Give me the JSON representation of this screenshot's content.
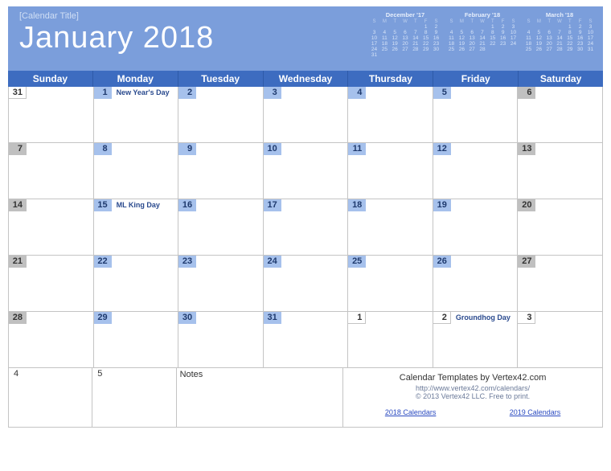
{
  "header": {
    "placeholder": "[Calendar Title]",
    "title": "January 2018",
    "mini": [
      {
        "title": "December '17",
        "dow": [
          "S",
          "M",
          "T",
          "W",
          "T",
          "F",
          "S"
        ],
        "rows": [
          [
            "",
            "",
            "",
            "",
            "",
            "1",
            "2"
          ],
          [
            "3",
            "4",
            "5",
            "6",
            "7",
            "8",
            "9"
          ],
          [
            "10",
            "11",
            "12",
            "13",
            "14",
            "15",
            "16"
          ],
          [
            "17",
            "18",
            "19",
            "20",
            "21",
            "22",
            "23"
          ],
          [
            "24",
            "25",
            "26",
            "27",
            "28",
            "29",
            "30"
          ],
          [
            "31",
            "",
            "",
            "",
            "",
            "",
            ""
          ]
        ]
      },
      {
        "title": "February '18",
        "dow": [
          "S",
          "M",
          "T",
          "W",
          "T",
          "F",
          "S"
        ],
        "rows": [
          [
            "",
            "",
            "",
            "",
            "1",
            "2",
            "3"
          ],
          [
            "4",
            "5",
            "6",
            "7",
            "8",
            "9",
            "10"
          ],
          [
            "11",
            "12",
            "13",
            "14",
            "15",
            "16",
            "17"
          ],
          [
            "18",
            "19",
            "20",
            "21",
            "22",
            "23",
            "24"
          ],
          [
            "25",
            "26",
            "27",
            "28",
            "",
            "",
            ""
          ]
        ]
      },
      {
        "title": "March '18",
        "dow": [
          "S",
          "M",
          "T",
          "W",
          "T",
          "F",
          "S"
        ],
        "rows": [
          [
            "",
            "",
            "",
            "",
            "1",
            "2",
            "3"
          ],
          [
            "4",
            "5",
            "6",
            "7",
            "8",
            "9",
            "10"
          ],
          [
            "11",
            "12",
            "13",
            "14",
            "15",
            "16",
            "17"
          ],
          [
            "18",
            "19",
            "20",
            "21",
            "22",
            "23",
            "24"
          ],
          [
            "25",
            "26",
            "27",
            "28",
            "29",
            "30",
            "31"
          ]
        ]
      }
    ]
  },
  "dow": [
    "Sunday",
    "Monday",
    "Tuesday",
    "Wednesday",
    "Thursday",
    "Friday",
    "Saturday"
  ],
  "weeks": [
    [
      {
        "n": "31",
        "type": "plain"
      },
      {
        "n": "1",
        "type": "blue",
        "event": "New Year's Day"
      },
      {
        "n": "2",
        "type": "blue"
      },
      {
        "n": "3",
        "type": "blue"
      },
      {
        "n": "4",
        "type": "blue"
      },
      {
        "n": "5",
        "type": "blue"
      },
      {
        "n": "6",
        "type": "gray"
      }
    ],
    [
      {
        "n": "7",
        "type": "gray"
      },
      {
        "n": "8",
        "type": "blue"
      },
      {
        "n": "9",
        "type": "blue"
      },
      {
        "n": "10",
        "type": "blue"
      },
      {
        "n": "11",
        "type": "blue"
      },
      {
        "n": "12",
        "type": "blue"
      },
      {
        "n": "13",
        "type": "gray"
      }
    ],
    [
      {
        "n": "14",
        "type": "gray"
      },
      {
        "n": "15",
        "type": "blue",
        "event": "ML King Day"
      },
      {
        "n": "16",
        "type": "blue"
      },
      {
        "n": "17",
        "type": "blue"
      },
      {
        "n": "18",
        "type": "blue"
      },
      {
        "n": "19",
        "type": "blue"
      },
      {
        "n": "20",
        "type": "gray"
      }
    ],
    [
      {
        "n": "21",
        "type": "gray"
      },
      {
        "n": "22",
        "type": "blue"
      },
      {
        "n": "23",
        "type": "blue"
      },
      {
        "n": "24",
        "type": "blue"
      },
      {
        "n": "25",
        "type": "blue"
      },
      {
        "n": "26",
        "type": "blue"
      },
      {
        "n": "27",
        "type": "gray"
      }
    ],
    [
      {
        "n": "28",
        "type": "gray"
      },
      {
        "n": "29",
        "type": "blue"
      },
      {
        "n": "30",
        "type": "blue"
      },
      {
        "n": "31",
        "type": "blue"
      },
      {
        "n": "1",
        "type": "plain"
      },
      {
        "n": "2",
        "type": "plain",
        "event": "Groundhog Day"
      },
      {
        "n": "3",
        "type": "plain"
      }
    ]
  ],
  "footer": {
    "day1": "4",
    "day2": "5",
    "notes_label": "Notes",
    "credit_title": "Calendar Templates by Vertex42.com",
    "credit_url": "http://www.vertex42.com/calendars/",
    "credit_copyright": "© 2013 Vertex42 LLC. Free to print.",
    "link1": "2018 Calendars",
    "link2": "2019 Calendars"
  }
}
